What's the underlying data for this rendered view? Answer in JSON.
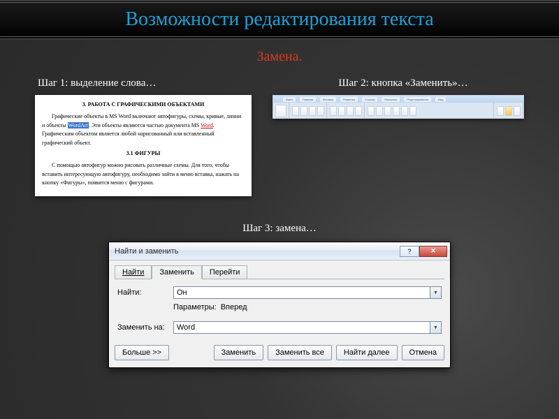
{
  "slide": {
    "title": "Возможности редактирования текста",
    "subtitle": "Замена."
  },
  "step1": {
    "label": "Шаг 1: выделение слова…",
    "doc": {
      "h1": "3. РАБОТА С ГРАФИЧЕСКИМИ ОБЪЕКТАМИ",
      "p1a": "Графические объекты в MS Word включают автофигуры, схемы, кривые, линии и объекты ",
      "p1_hl": "WordArt",
      "p1b": ". Эти объекты являются частью документа MS ",
      "p1_ul": "Word",
      "p1c": ". Графическим объектом является любой нарисованный или вставленный графический объект.",
      "h2": "3.1 ФИГУРЫ",
      "p2": "С помощью автофигур можно рисовать различные схемы. Для того, чтобы вставить интересующую автофигуру, необходимо зайти в меню вставка, нажать на кнопку «Фигуры», появится меню с фигурами."
    }
  },
  "step2": {
    "label": "Шаг 2: кнопка «Заменить»…",
    "ribbon_tabs": [
      "Файл",
      "Главная",
      "Вставка",
      "Разметка",
      "Ссылки",
      "Рассылки",
      "Рецензирование",
      "Вид"
    ]
  },
  "step3": {
    "label": "Шаг 3: замена…"
  },
  "dialog": {
    "title": "Найти и заменить",
    "tabs": {
      "find": "Найти",
      "replace": "Заменить",
      "goto": "Перейти"
    },
    "find_label": "Найти:",
    "find_value": "Он",
    "params_label": "Параметры:",
    "params_value": "Вперед",
    "replace_label": "Заменить на:",
    "replace_value": "Word",
    "buttons": {
      "more": "Больше >>",
      "replace": "Заменить",
      "replace_all": "Заменить все",
      "find_next": "Найти далее",
      "cancel": "Отмена"
    }
  }
}
